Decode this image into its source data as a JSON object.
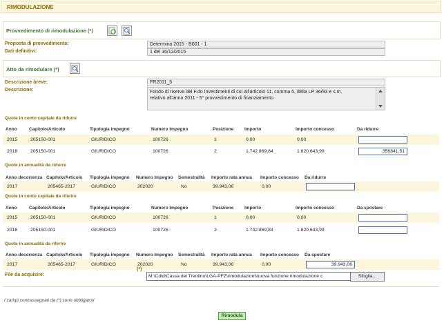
{
  "header": {
    "title": "RIMODULAZIONE"
  },
  "provvedimento": {
    "label": "Provvedimento di rimodulazione (*)"
  },
  "proposta": {
    "label": "Proposta di provvedimento:",
    "value": "Determina 2015 - B001 - 1"
  },
  "definitivi": {
    "label": "Dati definitivi:",
    "value": "1 del 16/12/2015"
  },
  "atto": {
    "label": "Atto da rimodulare (*)"
  },
  "desc_breve": {
    "label": "Descrizione breve:",
    "value": "FR2011_5"
  },
  "descrizione": {
    "label": "Descrizione:",
    "line1": "Fondo di riserva del F.do Investimenti di cui all'articolo 11, comma 5, della LP 36/93 e s.m.",
    "line2": "relativo all'anno 2011 - 5° provvedimento di finanziamento"
  },
  "sec1": {
    "title": "Quote in conto capitale da ridurre",
    "headers": [
      "Anno",
      "Capitolo/Articolo",
      "Tipologia impegno",
      "Numero Impegno",
      "Posizione",
      "Importo",
      "Importo concesso",
      "Da ridurre"
    ],
    "rows": [
      {
        "anno": "2015",
        "cap": "205150-001",
        "tip": "GIURIDICO",
        "num": "100726",
        "pos": "1",
        "imp": "0,00",
        "conc": "0,00",
        "val": ""
      },
      {
        "anno": "2018",
        "cap": "205150-001",
        "tip": "GIURIDICO",
        "num": "100726",
        "pos": "2",
        "imp": "1.742.869,84",
        "conc": "1.820.643,99",
        "val": "356841,51"
      }
    ]
  },
  "sec2": {
    "title": "Quote in annualità da ridurre",
    "headers": [
      "Anno decorrenza",
      "Capitolo/Articolo",
      "Tipologia impegno",
      "Numero Impegno",
      "Semestralità",
      "Importo rata annua",
      "Importo concesso",
      "Da ridurre"
    ],
    "rows": [
      {
        "anno": "2017",
        "cap": "205465-2017",
        "tip": "GIURIDICO",
        "num": "202020",
        "sem": "No",
        "rata": "39.943,06",
        "conc": "0,00",
        "val": ""
      }
    ]
  },
  "sec3": {
    "title": "Quote in conto capitale da riferire",
    "headers": [
      "Anno",
      "Capitolo/Articolo",
      "Tipologia impegno",
      "Numero Impegno",
      "Posizione",
      "Importo",
      "Importo concesso",
      "Da spostare"
    ],
    "rows": [
      {
        "anno": "2015",
        "cap": "205150-001",
        "tip": "GIURIDICO",
        "num": "100726",
        "pos": "1",
        "imp": "0,00",
        "conc": "0,00",
        "val": ""
      },
      {
        "anno": "2018",
        "cap": "205150-001",
        "tip": "GIURIDICO",
        "num": "100726",
        "pos": "2",
        "imp": "1.742.869,84",
        "conc": "1.820.643,99",
        "val": ""
      }
    ]
  },
  "sec4": {
    "title": "Quote in annualità da riferire",
    "headers": [
      "Anno decorrenza",
      "Capitolo/Articolo",
      "Tipologia impegno",
      "Numero Impegno",
      "Semestralità",
      "Importo rata annua",
      "Importo concesso",
      "Da spostare"
    ],
    "rows": [
      {
        "anno": "2017",
        "cap": "205465-2017",
        "tip": "GIURIDICO",
        "num": "202020",
        "sem": "No",
        "rata": "39.943,06",
        "conc": "0,00",
        "val": "39.943,06"
      }
    ]
  },
  "file": {
    "label": "File da acquisire:",
    "required": "(*)",
    "value": "M:\\Cdtd\\Cassa del Trentino\\LGA-PFZ\\rimodulazioni\\nuova funzione rimodulazione c",
    "browse": "Sfoglia..."
  },
  "note": "I campi contrassegnati da (*) sono obbligatori",
  "submit": "Rimodula"
}
